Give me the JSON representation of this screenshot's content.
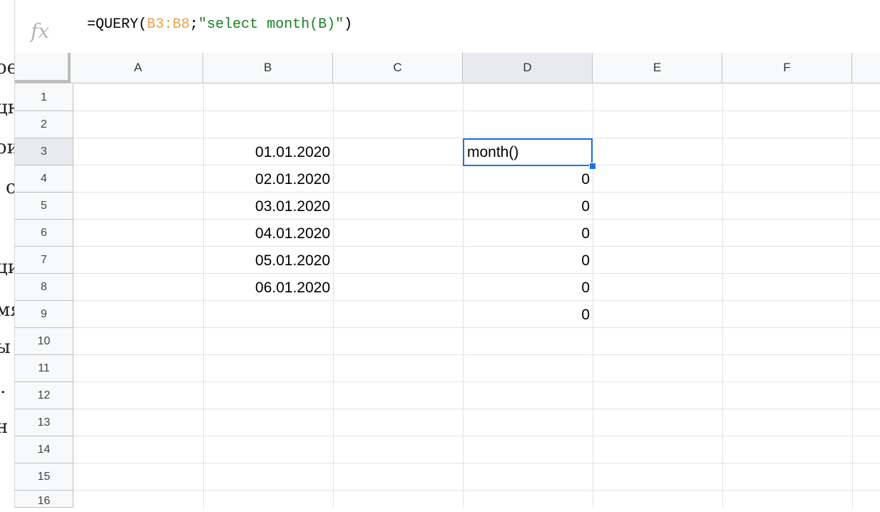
{
  "background_doc": {
    "glyphs": [
      "ое",
      "цн",
      "ои",
      "с",
      "ци",
      "мя",
      "ы",
      ".",
      "н"
    ]
  },
  "formula_bar": {
    "fx_label": "fx",
    "prefix": "=QUERY(",
    "range": "B3:B8",
    "separator": ";",
    "string_arg": "\"select month(B)\"",
    "suffix": ")"
  },
  "columns": [
    "A",
    "B",
    "C",
    "D",
    "E",
    "F"
  ],
  "rows": [
    "1",
    "2",
    "3",
    "4",
    "5",
    "6",
    "7",
    "8",
    "9",
    "10",
    "11",
    "12",
    "13",
    "14",
    "15",
    "16"
  ],
  "cells": {
    "B3": "01.01.2020",
    "B4": "02.01.2020",
    "B5": "03.01.2020",
    "B6": "04.01.2020",
    "B7": "05.01.2020",
    "B8": "06.01.2020",
    "D3": "month()",
    "D4": "0",
    "D5": "0",
    "D6": "0",
    "D7": "0",
    "D8": "0",
    "D9": "0"
  },
  "active_cell": "D3",
  "colors": {
    "selection": "#1a73e8",
    "range_ref": "#e8a148",
    "string_literal": "#18801f"
  }
}
